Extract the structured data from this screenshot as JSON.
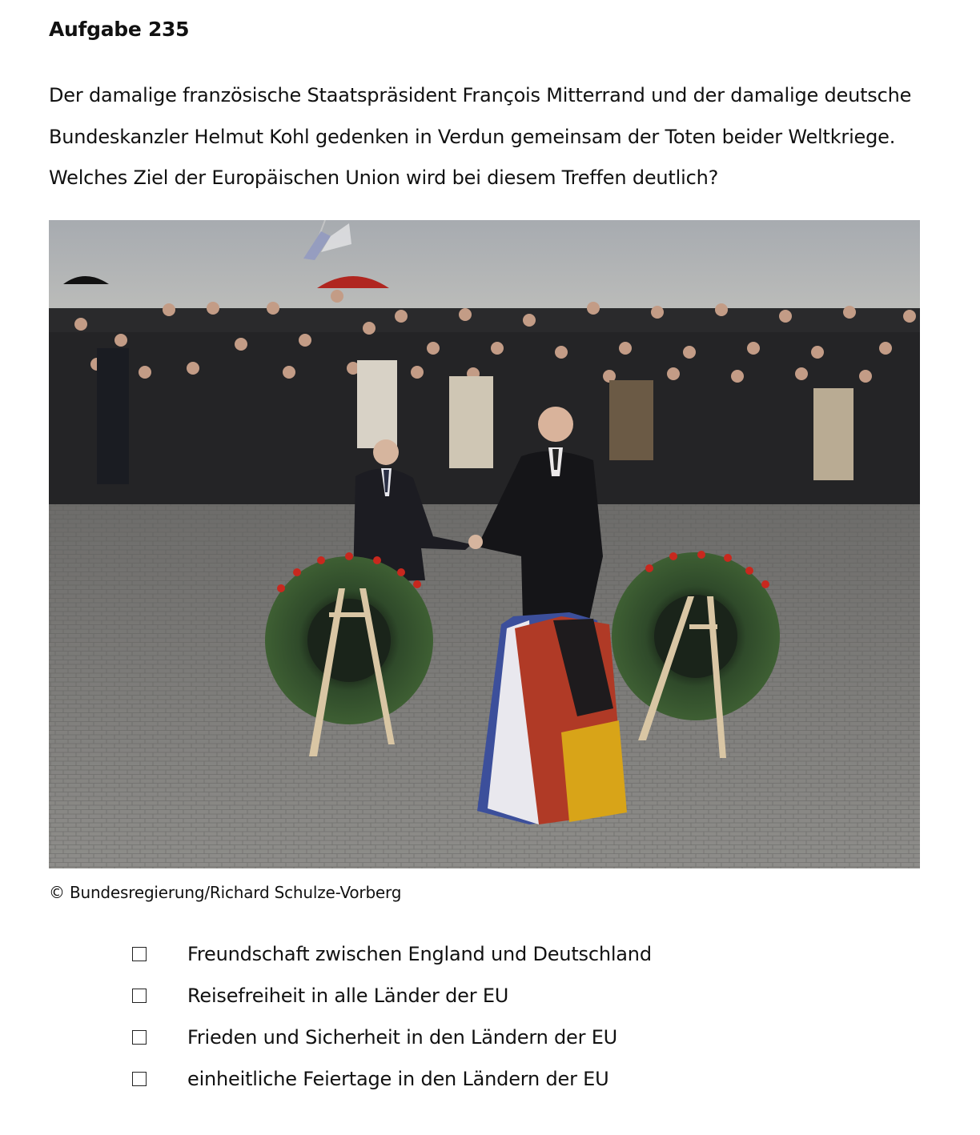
{
  "task": {
    "title": "Aufgabe 235",
    "question_lines": [
      "Der damalige französische Staatspräsident François Mitterrand und der damalige deutsche",
      "Bundeskanzler Helmut Kohl gedenken in Verdun gemeinsam der Toten beider Weltkriege.",
      "Welches Ziel der Europäischen Union wird bei diesem Treffen deutlich?"
    ]
  },
  "photo": {
    "credit": "© Bundesregierung/Richard Schulze-Vorberg"
  },
  "options": [
    {
      "label": "Freundschaft zwischen England und Deutschland",
      "checked": false
    },
    {
      "label": "Reisefreiheit in alle Länder der EU",
      "checked": false
    },
    {
      "label": "Frieden und Sicherheit in den Ländern der EU",
      "checked": false
    },
    {
      "label": "einheitliche Feiertage in den Ländern der EU",
      "checked": false
    }
  ]
}
